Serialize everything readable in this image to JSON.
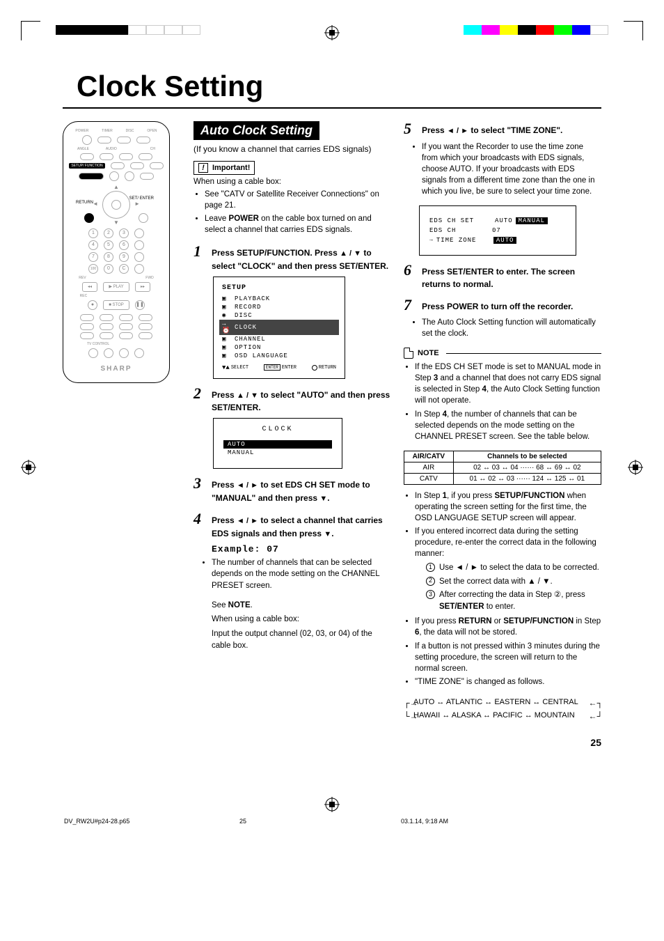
{
  "topstrip_colors_left": [
    "#000",
    "#000",
    "#000",
    "#000",
    "#fff",
    "#fff",
    "#fff",
    "#fff"
  ],
  "topstrip_colors_right": [
    "#0ff",
    "#f0f",
    "#ff0",
    "#000",
    "#f00",
    "#0f0",
    "#00f",
    "#fff"
  ],
  "page_title": "Clock Setting",
  "remote": {
    "row1": [
      "POWER",
      "TIMER",
      "DISC",
      "OPEN"
    ],
    "row2": [
      "ANGLE",
      "AUDIO",
      "CH"
    ],
    "setup_label": "SETUP/\nFUNCTION",
    "return_label": "RETURN",
    "set_enter_label": "SET/\nENTER",
    "numbers": [
      "1",
      "2",
      "3",
      "4",
      "5",
      "6",
      "7",
      "8",
      "9",
      "100",
      "0",
      "C"
    ],
    "play": "PLAY",
    "stop": "STOP",
    "tv": "TV CONTROL",
    "brand": "SHARP"
  },
  "section_header": "Auto Clock Setting",
  "intro": "(If you know a channel that carries EDS signals)",
  "important_label": "Important!",
  "important_intro": "When using a cable box:",
  "important_items": [
    "See \"CATV or Satellite Receiver Connections\" on page 21.",
    "Leave POWER on the cable box turned on and select a channel that carries EDS signals."
  ],
  "steps": {
    "s1": {
      "num": "1",
      "txt_a": "Press ",
      "kw1": "SETUP/FUNCTION",
      "txt_b": ". Press ",
      "arr": "▲ / ▼",
      "txt_c": " to select \"CLOCK\" and then press ",
      "kw2": "SET/ENTER",
      "txt_d": "."
    },
    "s2": {
      "num": "2",
      "txt_a": "Press ",
      "arr": "▲ / ▼",
      "txt_b": " to select \"AUTO\" and then press ",
      "kw": "SET/ENTER",
      "txt_c": "."
    },
    "s3": {
      "num": "3",
      "txt_a": "Press ",
      "arr": "◄ / ►",
      "txt_b": " to set EDS CH SET mode to \"MANUAL\" and then press ",
      "arr2": "▼",
      "txt_c": "."
    },
    "s4": {
      "num": "4",
      "txt_a": "Press ",
      "arr": "◄ / ►",
      "txt_b": " to select a channel that carries EDS signals and then press ",
      "arr2": "▼",
      "txt_c": "."
    },
    "s5": {
      "num": "5",
      "txt_a": "Press ",
      "arr": "◄ / ►",
      "txt_b": " to select \"TIME ZONE\"."
    },
    "s6": {
      "num": "6",
      "txt_a": "Press ",
      "kw": "SET/ENTER",
      "txt_b": " to enter. The screen returns to normal."
    },
    "s7": {
      "num": "7",
      "txt_a": "Press ",
      "kw": "POWER",
      "txt_b": " to turn off the recorder."
    }
  },
  "osd1": {
    "header": "SETUP",
    "items": [
      "PLAYBACK",
      "RECORD",
      "DISC",
      "CLOCK",
      "CHANNEL",
      "OPTION",
      "OSD LANGUAGE"
    ],
    "highlight_index": 3,
    "footer": {
      "select": "SELECT",
      "enter": "ENTER",
      "return": "RETURN"
    }
  },
  "osd2": {
    "title": "CLOCK",
    "items": [
      "AUTO",
      "MANUAL"
    ],
    "sel_index": 0
  },
  "example_label": "Example: 07",
  "step4_bullets": [
    "The number of channels that can be selected depends on the mode setting on the CHANNEL PRESET screen."
  ],
  "step4_see": "See NOTE.",
  "step4_cable_intro": "When using a cable box:",
  "step4_cable_txt": "Input the output channel (02, 03, or 04) of the cable box.",
  "step5_bullet": "If you want the Recorder to use the time zone from which your broadcasts with EDS signals, choose AUTO. If your broadcasts with EDS signals from a different time zone than the one in which you live, be sure to select your time zone.",
  "osd3": {
    "rows": [
      {
        "k": "EDS CH SET",
        "v1": "AUTO",
        "v2": "MANUAL",
        "sel": 1
      },
      {
        "k": "EDS CH",
        "v": "07"
      },
      {
        "k": "TIME ZONE",
        "v": "AUTO",
        "pointer": true,
        "box": true
      }
    ]
  },
  "step7_bullet": "The Auto Clock Setting function will automatically set the clock.",
  "note_label": "NOTE",
  "notes": [
    "If the EDS CH SET mode is set to MANUAL mode in Step 3 and a channel that does not carry EDS signal is selected in Step 4, the Auto Clock Setting function will not operate.",
    "In Step 4, the number of channels that can be selected depends on the mode setting on the CHANNEL PRESET screen. See the table below."
  ],
  "table": {
    "head": [
      "AIR/CATV",
      "Channels to be selected"
    ],
    "rows": [
      [
        "AIR",
        "02 ↔ 03 ↔ 04 ······ 68 ↔ 69 ↔ 02"
      ],
      [
        "CATV",
        "01 ↔ 02 ↔ 03 ······ 124 ↔ 125 ↔ 01"
      ]
    ]
  },
  "notes2": [
    "In Step 1, if you press SETUP/FUNCTION when operating the screen setting for the first time, the OSD LANGUAGE SETUP screen will appear.",
    "If you entered incorrect data during the setting procedure, re-enter the correct data in the following manner:"
  ],
  "sublist": [
    "Use ◄ / ► to select the data to be corrected.",
    "Set the correct data with ▲ / ▼.",
    "After correcting the data in Step ②, press SET/ENTER to enter."
  ],
  "notes3": [
    "If you press RETURN or SETUP/FUNCTION in Step 6, the data will not be stored.",
    "If a button is not pressed within 3 minutes during the setting procedure, the screen will return to the normal screen.",
    "\"TIME ZONE\" is changed as follows."
  ],
  "tz_chain": {
    "line1": "AUTO ↔ ATLANTIC ↔ EASTERN ↔ CENTRAL",
    "line2": "HAWAII ↔ ALASKA ↔ PACIFIC ↔ MOUNTAIN"
  },
  "page_number": "25",
  "footer_file": "DV_RW2U#p24-28.p65",
  "footer_page": "25",
  "footer_date": "03.1.14, 9:18 AM"
}
